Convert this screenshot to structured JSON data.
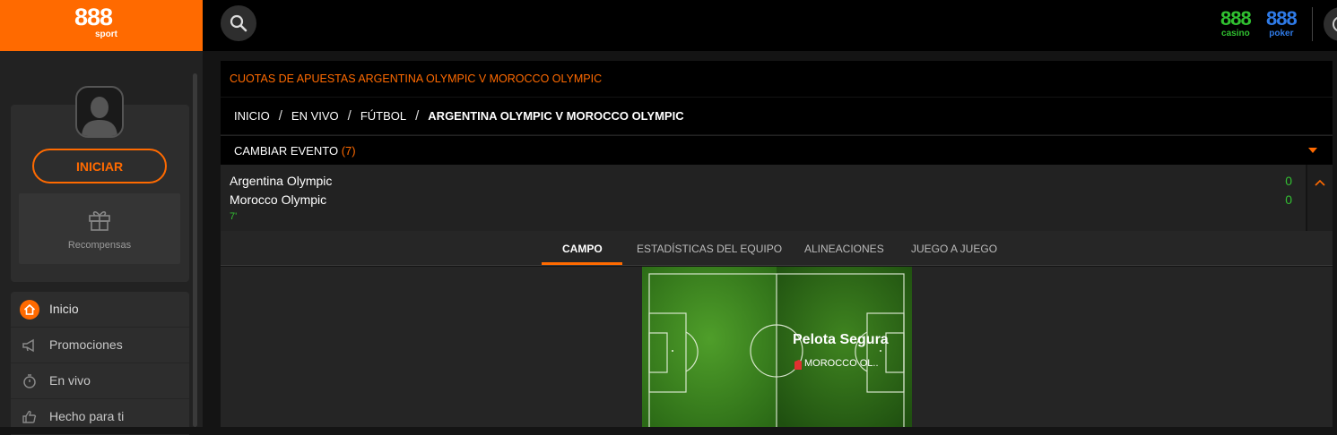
{
  "header": {
    "logo": "888",
    "logo_sub": "sport",
    "casino_num": "888",
    "casino_label": "casino",
    "poker_num": "888",
    "poker_label": "poker"
  },
  "sidebar": {
    "login_label": "INICIAR",
    "rewards_label": "Recompensas",
    "items": [
      {
        "label": "Inicio",
        "icon": "home-icon"
      },
      {
        "label": "Promociones",
        "icon": "megaphone-icon"
      },
      {
        "label": "En vivo",
        "icon": "stopwatch-icon"
      },
      {
        "label": "Hecho para ti",
        "icon": "thumbs-up-icon"
      }
    ]
  },
  "main": {
    "title": "CUOTAS DE APUESTAS ARGENTINA OLYMPIC V MOROCCO OLYMPIC",
    "breadcrumb": [
      "INICIO",
      "EN VIVO",
      "FÚTBOL",
      "ARGENTINA OLYMPIC V MOROCCO OLYMPIC"
    ],
    "change_event_label": "CAMBIAR EVENTO",
    "change_event_count": "(7)",
    "match": {
      "home_team": "Argentina Olympic",
      "away_team": "Morocco Olympic",
      "home_score": "0",
      "away_score": "0",
      "minute": "7'"
    },
    "tabs": [
      "CAMPO",
      "ESTADÍSTICAS DEL EQUIPO",
      "ALINEACIONES",
      "JUEGO A JUEGO"
    ],
    "active_tab": "CAMPO",
    "pitch": {
      "status": "Pelota Segura",
      "team": "MOROCCO OL.."
    }
  },
  "colors": {
    "accent": "#ff6a00",
    "score_green": "#33c033",
    "casino_green": "#30c030",
    "poker_blue": "#2f7be8"
  }
}
